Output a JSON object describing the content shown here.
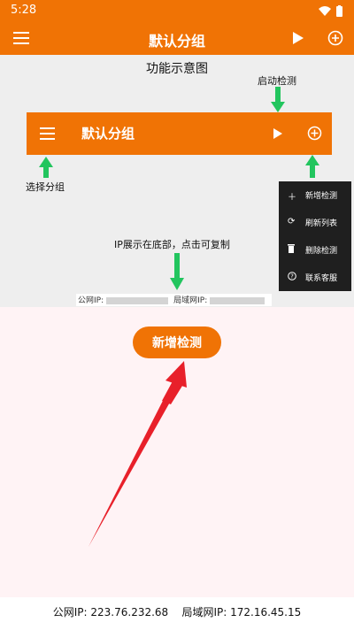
{
  "status_bar": {
    "time": "5:28"
  },
  "app_bar": {
    "title": "默认分组",
    "icons": [
      "menu-icon",
      "play-icon",
      "add-circle-icon"
    ]
  },
  "demo": {
    "title": "功能示意图",
    "label_start": "启动检测",
    "label_select": "选择分组",
    "label_ip": "IP展示在底部，点击可复制",
    "bar_title": "默认分组",
    "menu_items": [
      {
        "icon": "plus-icon",
        "label": "新增检测"
      },
      {
        "icon": "refresh-icon",
        "label": "刷新列表"
      },
      {
        "icon": "trash-icon",
        "label": "删除检测"
      },
      {
        "icon": "help-icon",
        "label": "联系客服"
      }
    ],
    "ip_public_label": "公网IP:",
    "ip_lan_label": "局域网IP:"
  },
  "main": {
    "add_button": "新增检测"
  },
  "footer": {
    "public_ip_label": "公网IP:",
    "public_ip": "223.76.232.68",
    "lan_ip_label": "局域网IP:",
    "lan_ip": "172.16.45.15"
  },
  "colors": {
    "accent": "#f07305",
    "arrow_green": "#22c55e",
    "arrow_red": "#e8202a",
    "menu_bg": "#1f1f1f"
  }
}
